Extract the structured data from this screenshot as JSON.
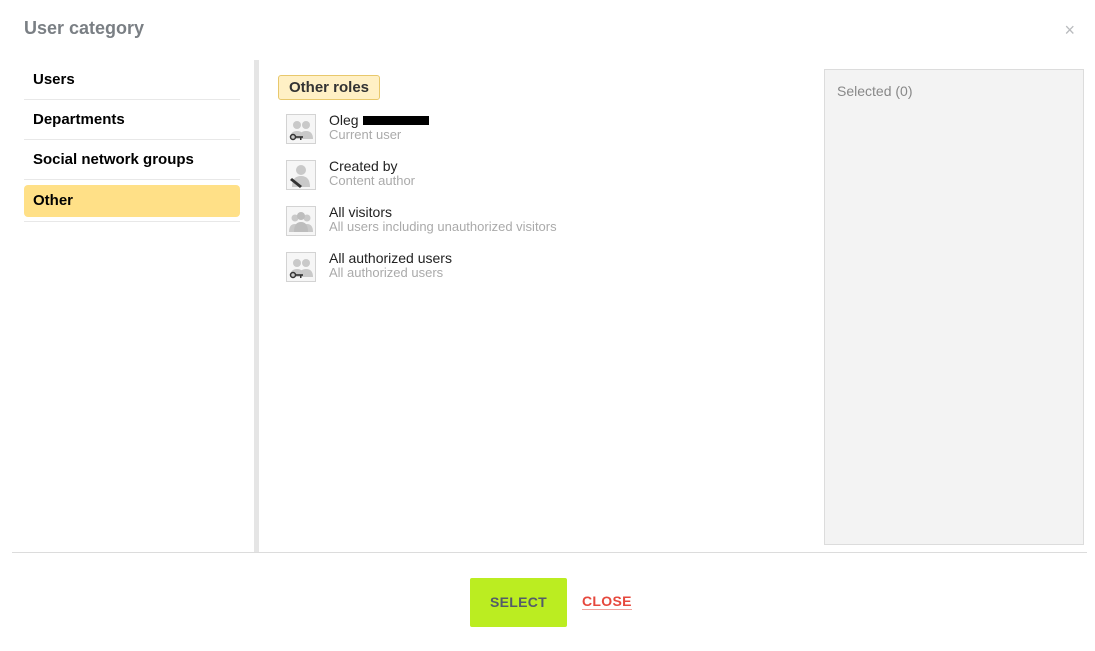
{
  "dialog": {
    "title": "User category",
    "close_glyph": "×"
  },
  "sidebar": {
    "items": [
      {
        "label": "Users"
      },
      {
        "label": "Departments"
      },
      {
        "label": "Social network groups"
      },
      {
        "label": "Other",
        "active": true
      }
    ]
  },
  "main": {
    "section_label": "Other roles",
    "items": [
      {
        "name": "Oleg",
        "desc": "Current user",
        "icon": "user-key-icon"
      },
      {
        "name": "Created by",
        "desc": "Content author",
        "icon": "user-pen-icon"
      },
      {
        "name": "All visitors",
        "desc": "All users including unauthorized visitors",
        "icon": "users-group-icon"
      },
      {
        "name": "All authorized users",
        "desc": "All authorized users",
        "icon": "users-key-icon"
      }
    ]
  },
  "selected_panel": {
    "label": "Selected (0)"
  },
  "footer": {
    "select_label": "SELECT",
    "close_label": "CLOSE"
  },
  "colors": {
    "active_nav_bg": "#ffe087",
    "select_button": "#bbed21",
    "close_link": "#e6483d"
  }
}
